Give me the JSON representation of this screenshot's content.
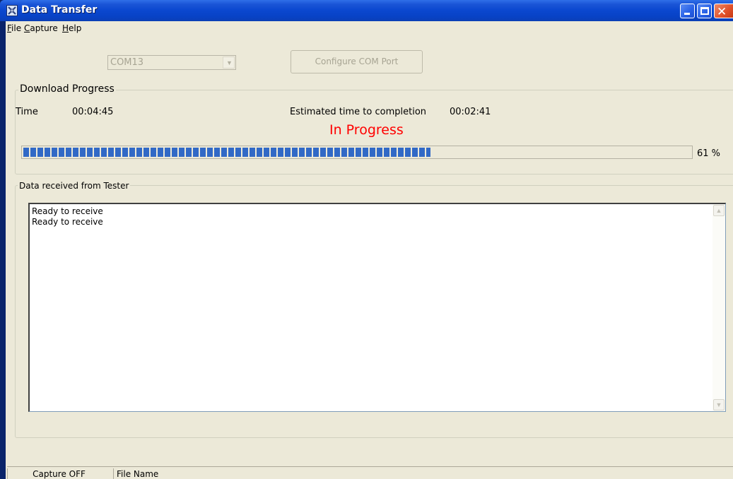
{
  "window": {
    "title": "Data Transfer",
    "colors": {
      "title_bar": "#0842c5",
      "face": "#ece9d8",
      "progress": "#3169c6",
      "status": "#ff0000"
    }
  },
  "menu": {
    "items": [
      {
        "label": "File",
        "accel": "F",
        "rest": "ile"
      },
      {
        "label": "Capture",
        "accel": "C",
        "rest": "apture"
      },
      {
        "label": "Help",
        "accel": "H",
        "rest": "elp"
      }
    ]
  },
  "com_port": {
    "selected": "COM13",
    "enabled": false
  },
  "configure_button": {
    "label": "Configure COM Port",
    "enabled": false
  },
  "download": {
    "group_label": "Download Progress",
    "time_label": "Time",
    "time_value": "00:04:45",
    "eta_label": "Estimated time to completion",
    "eta_value": "00:02:41",
    "status": "In Progress",
    "progress_fraction": 0.61,
    "progress_text": "61 %"
  },
  "received": {
    "group_label": "Data received from Tester",
    "lines": [
      "Ready to receive",
      "Ready to receive"
    ]
  },
  "statusbar": {
    "capture": "Capture OFF",
    "file": "File Name"
  },
  "icons": {
    "app": "satellite-icon",
    "minimize": "minimize-icon",
    "maximize": "maximize-icon",
    "close": "close-icon",
    "dropdown": "chevron-down-icon",
    "scroll_up": "scroll-up-icon",
    "scroll_down": "scroll-down-icon"
  }
}
